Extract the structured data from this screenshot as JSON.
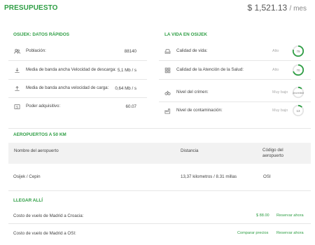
{
  "header": {
    "title": "PRESUPUESTO",
    "price": "$ 1,521.13",
    "price_unit": "/ mes"
  },
  "quick_data": {
    "title": "OSIJEK: DATOS RÁPIDOS",
    "rows": [
      {
        "icon": "people-icon",
        "label": "Población:",
        "value": "88140"
      },
      {
        "icon": "download-icon",
        "label": "Media de banda ancha Velocidad de descarga:",
        "value": "5,1 Mb / s"
      },
      {
        "icon": "upload-icon",
        "label": "Media de banda ancha velocidad de carga:",
        "value": "0,64 Mb / s"
      },
      {
        "icon": "money-icon",
        "label": "Poder adquisitivo:",
        "value": "60.07"
      }
    ]
  },
  "life": {
    "title": "LA VIDA EN OSIJEK",
    "rows": [
      {
        "icon": "sofa-icon",
        "label": "Calidad de vida:",
        "level": "Alto",
        "score": "79",
        "fraction": 0.79
      },
      {
        "icon": "health-icon",
        "label": "Calidad de la Atención de la Salud:",
        "level": "Alto",
        "score": "70",
        "fraction": 0.7
      },
      {
        "icon": "handcuffs-icon",
        "label": "Nivel del crimen:",
        "level": "Muy bajo",
        "score": "¡Increíble",
        "fraction": 0.12
      },
      {
        "icon": "factory-icon",
        "label": "Nivel de contaminación:",
        "level": "Muy bajo",
        "score": "13",
        "fraction": 0.13
      }
    ],
    "colors": {
      "gauge": "#2e9e44",
      "track": "#e4e4e4"
    }
  },
  "airports": {
    "title": "AEROPUERTOS A 50 KM",
    "headers": {
      "name": "Nombre del aeropuerto",
      "distance": "Distancia",
      "code": "Código del aeropuerto"
    },
    "rows": [
      {
        "name": "Osijek / Cepin",
        "distance": "13,37 kilometros / 8.31 millas",
        "code": "OSI"
      }
    ]
  },
  "getting_there": {
    "title": "LLEGAR ALLÍ",
    "rows": [
      {
        "label": "Costo de vuelo de Madrid a Croacia:",
        "price": "$ 88.00",
        "action": "Reservar ahora"
      },
      {
        "label": "Costo de vuelo de Madrid a OSI:",
        "compare": "Comparar precios",
        "action": "Reservar ahora"
      }
    ]
  },
  "accent_color": "#2e9e44"
}
